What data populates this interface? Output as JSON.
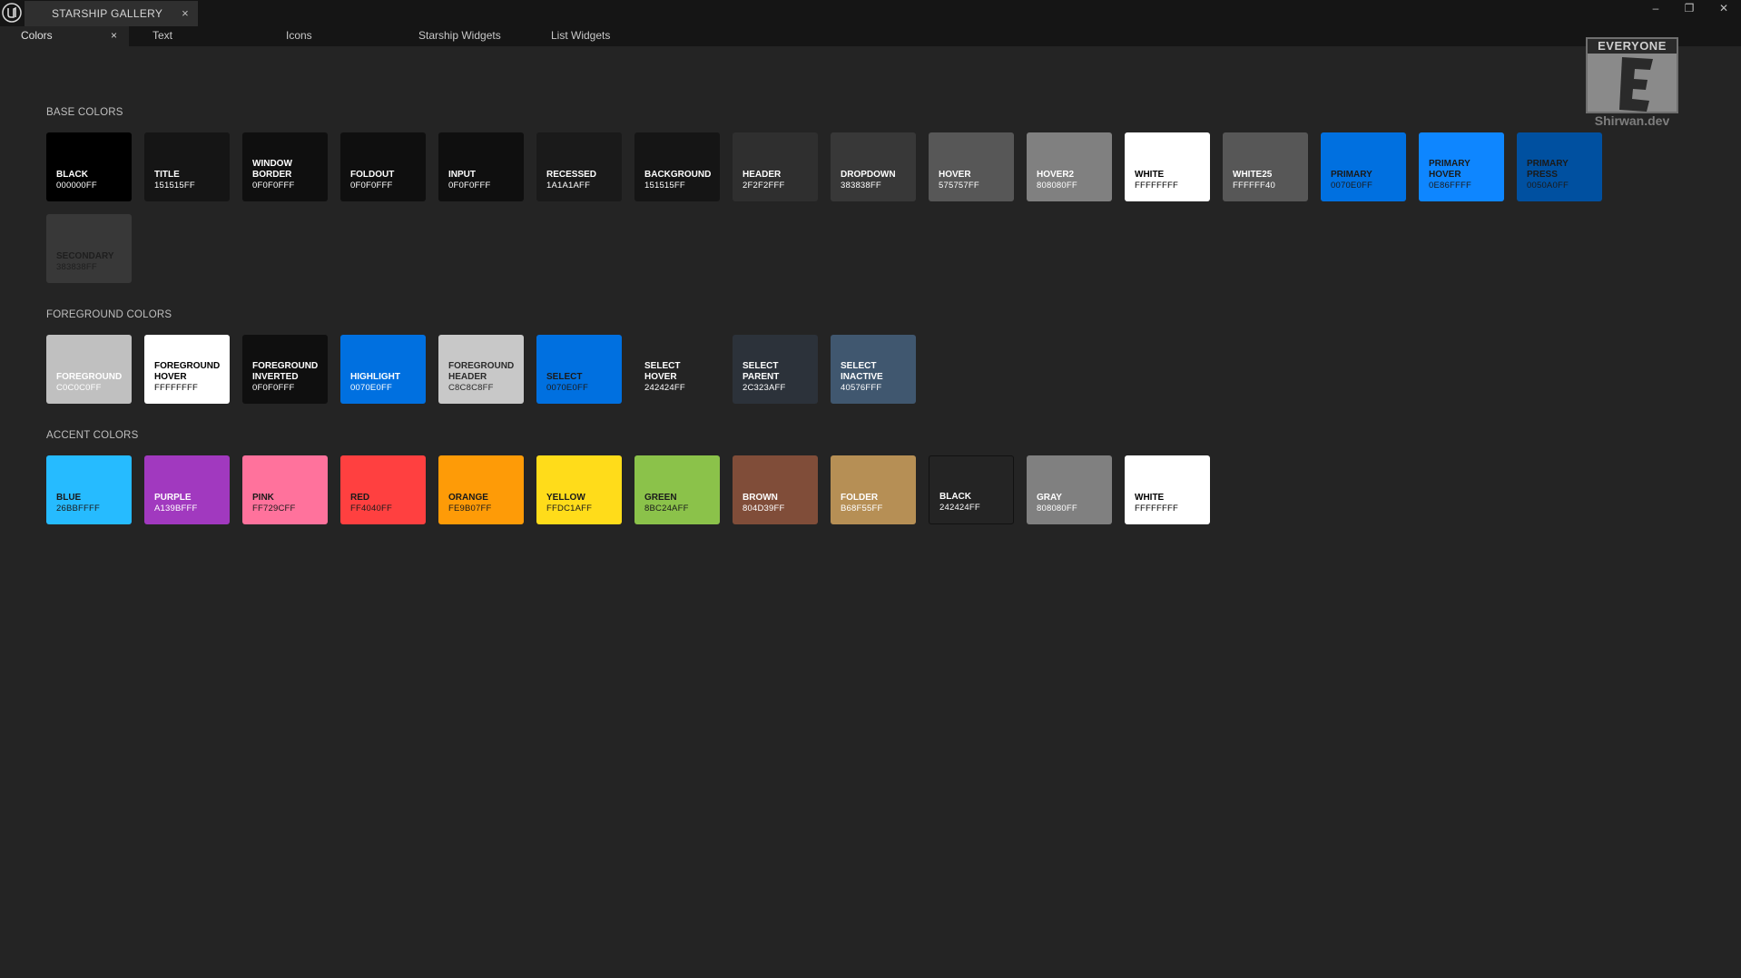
{
  "titlebar": {
    "doc_tab_label": "STARSHIP GALLERY",
    "doc_tab_close": "×",
    "minimize_glyph": "–",
    "restore_glyph": "❐",
    "close_glyph": "✕",
    "logo_icon": "unreal-engine-logo"
  },
  "tabs": [
    {
      "label": "Colors",
      "close": "×",
      "active": true
    },
    {
      "label": "Text"
    },
    {
      "label": "Icons"
    },
    {
      "label": "Starship Widgets"
    },
    {
      "label": "List Widgets"
    }
  ],
  "rating": {
    "header": "EVERYONE",
    "footer": "Shirwan.dev"
  },
  "sections": {
    "base": {
      "title": "BASE COLORS",
      "swatches": [
        {
          "name": "BLACK",
          "hex": "000000FF",
          "bg": "#000000",
          "fg": "#ffffff"
        },
        {
          "name": "TITLE",
          "hex": "151515FF",
          "bg": "#151515",
          "fg": "#ffffff"
        },
        {
          "name": "WINDOW\nBORDER",
          "hex": "0F0F0FFF",
          "bg": "#0f0f0f",
          "fg": "#ffffff"
        },
        {
          "name": "FOLDOUT",
          "hex": "0F0F0FFF",
          "bg": "#0f0f0f",
          "fg": "#ffffff"
        },
        {
          "name": "INPUT",
          "hex": "0F0F0FFF",
          "bg": "#0f0f0f",
          "fg": "#ffffff"
        },
        {
          "name": "RECESSED",
          "hex": "1A1A1AFF",
          "bg": "#1a1a1a",
          "fg": "#ffffff"
        },
        {
          "name": "BACKGROUND",
          "hex": "151515FF",
          "bg": "#151515",
          "fg": "#ffffff"
        },
        {
          "name": "HEADER",
          "hex": "2F2F2FFF",
          "bg": "#2f2f2f",
          "fg": "#ffffff"
        },
        {
          "name": "DROPDOWN",
          "hex": "383838FF",
          "bg": "#383838",
          "fg": "#ffffff"
        },
        {
          "name": "HOVER",
          "hex": "575757FF",
          "bg": "#575757",
          "fg": "#ffffff"
        },
        {
          "name": "HOVER2",
          "hex": "808080FF",
          "bg": "#808080",
          "fg": "#ffffff"
        },
        {
          "name": "WHITE",
          "hex": "FFFFFFFF",
          "bg": "#ffffff",
          "fg": "#000000"
        },
        {
          "name": "WHITE25",
          "hex": "FFFFFF40",
          "bg": "#575757",
          "fg": "#ffffff"
        },
        {
          "name": "PRIMARY",
          "hex": "0070E0FF",
          "bg": "#0070e0",
          "fg": "#1a1a1a"
        },
        {
          "name": "PRIMARY\nHOVER",
          "hex": "0E86FFFF",
          "bg": "#0e86ff",
          "fg": "#1a1a1a"
        },
        {
          "name": "PRIMARY\nPRESS",
          "hex": "0050A0FF",
          "bg": "#0050a0",
          "fg": "#1a1a1a"
        },
        {
          "name": "SECONDARY",
          "hex": "383838FF",
          "bg": "#383838",
          "fg": "#1e1e1e"
        }
      ]
    },
    "foreground": {
      "title": "FOREGROUND COLORS",
      "swatches": [
        {
          "name": "FOREGROUND",
          "hex": "C0C0C0FF",
          "bg": "#c0c0c0",
          "fg": "#ffffff"
        },
        {
          "name": "FOREGROUND\nHOVER",
          "hex": "FFFFFFFF",
          "bg": "#ffffff",
          "fg": "#000000"
        },
        {
          "name": "FOREGROUND\nINVERTED",
          "hex": "0F0F0FFF",
          "bg": "#0f0f0f",
          "fg": "#ffffff"
        },
        {
          "name": "HIGHLIGHT",
          "hex": "0070E0FF",
          "bg": "#0070e0",
          "fg": "#ffffff"
        },
        {
          "name": "FOREGROUND\nHEADER",
          "hex": "C8C8C8FF",
          "bg": "#c8c8c8",
          "fg": "#2a2a2a"
        },
        {
          "name": "SELECT",
          "hex": "0070E0FF",
          "bg": "#0070e0",
          "fg": "#1a1a1a"
        },
        {
          "name": "SELECT\nHOVER",
          "hex": "242424FF",
          "bg": "#242424",
          "fg": "#ffffff"
        },
        {
          "name": "SELECT\nPARENT",
          "hex": "2C323AFF",
          "bg": "#2c323a",
          "fg": "#ffffff"
        },
        {
          "name": "SELECT\nINACTIVE",
          "hex": "40576FFF",
          "bg": "#40576f",
          "fg": "#ffffff"
        }
      ]
    },
    "accent": {
      "title": "ACCENT COLORS",
      "swatches": [
        {
          "name": "BLUE",
          "hex": "26BBFFFF",
          "bg": "#26bbff",
          "fg": "#1a1a1a"
        },
        {
          "name": "PURPLE",
          "hex": "A139BFFF",
          "bg": "#a139bf",
          "fg": "#ffffff"
        },
        {
          "name": "PINK",
          "hex": "FF729CFF",
          "bg": "#ff729c",
          "fg": "#1a1a1a"
        },
        {
          "name": "RED",
          "hex": "FF4040FF",
          "bg": "#ff4040",
          "fg": "#1a1a1a"
        },
        {
          "name": "ORANGE",
          "hex": "FE9B07FF",
          "bg": "#fe9b07",
          "fg": "#1a1a1a"
        },
        {
          "name": "YELLOW",
          "hex": "FFDC1AFF",
          "bg": "#ffdc1a",
          "fg": "#1a1a1a"
        },
        {
          "name": "GREEN",
          "hex": "8BC24AFF",
          "bg": "#8bc24a",
          "fg": "#1a1a1a"
        },
        {
          "name": "BROWN",
          "hex": "804D39FF",
          "bg": "#804d39",
          "fg": "#ffffff"
        },
        {
          "name": "FOLDER",
          "hex": "B68F55FF",
          "bg": "#b68f55",
          "fg": "#ffffff"
        },
        {
          "name": "BLACK",
          "hex": "242424FF",
          "bg": "#242424",
          "fg": "#ffffff",
          "border": "#111111"
        },
        {
          "name": "GRAY",
          "hex": "808080FF",
          "bg": "#808080",
          "fg": "#ffffff"
        },
        {
          "name": "WHITE",
          "hex": "FFFFFFFF",
          "bg": "#ffffff",
          "fg": "#000000"
        }
      ]
    }
  }
}
